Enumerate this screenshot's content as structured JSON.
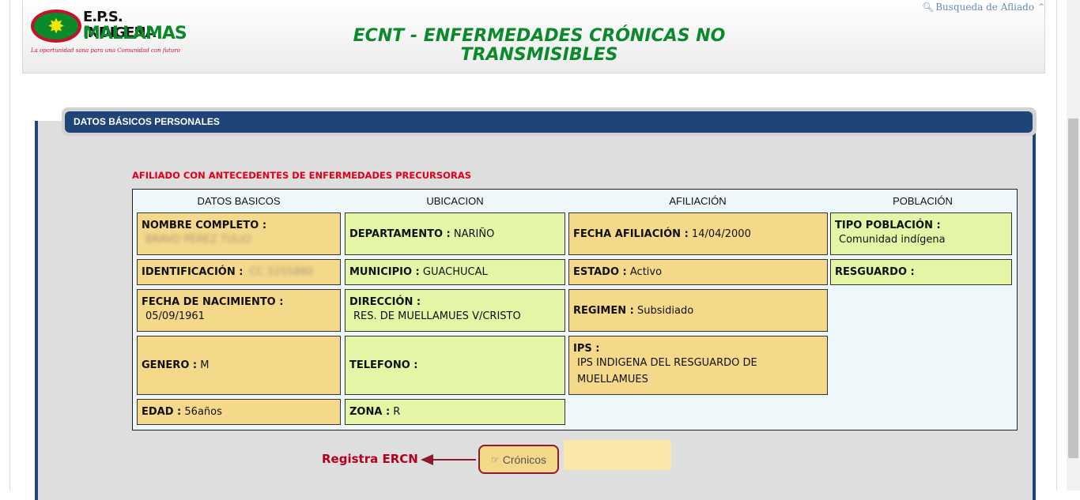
{
  "header": {
    "logo_line1": "E.P.S. INDIGENA",
    "logo_line2": "MALLAMAS",
    "logo_tagline": "La oportunidad sana para una Comunidad con futuro",
    "title": "ECNT - ENFERMEDADES CRÓNICAS NO TRANSMISIBLES",
    "search_link": "Busqueda de Afliado"
  },
  "panel": {
    "title": "DATOS BÁSICOS PERSONALES",
    "alert": "AFILIADO CON ANTECEDENTES DE ENFERMEDADES PRECURSORAS",
    "columns": [
      "DATOS BASICOS",
      "UBICACION",
      "AFILIACIÓN",
      "POBLACIÓN"
    ],
    "basic": {
      "nombre_label": "NOMBRE COMPLETO",
      "nombre_value": "BRAVO PEREZ TULIO",
      "id_label": "IDENTIFICACIÓN",
      "id_value": "CC 5255880",
      "nacimiento_label": "FECHA DE NACIMIENTO",
      "nacimiento_value": "05/09/1961",
      "genero_label": "GENERO",
      "genero_value": "M",
      "edad_label": "EDAD",
      "edad_value": "56años"
    },
    "ubicacion": {
      "departamento_label": "DEPARTAMENTO",
      "departamento_value": "NARIÑO",
      "municipio_label": "MUNICIPIO",
      "municipio_value": "GUACHUCAL",
      "direccion_label": "DIRECCIÓN",
      "direccion_value": "RES. DE MUELLAMUES V/CRISTO",
      "telefono_label": "TELEFONO",
      "telefono_value": "",
      "zona_label": "ZONA",
      "zona_value": "R"
    },
    "afiliacion": {
      "fecha_label": "FECHA AFILIACIÓN",
      "fecha_value": "14/04/2000",
      "estado_label": "ESTADO",
      "estado_value": "Activo",
      "regimen_label": "REGIMEN",
      "regimen_value": "Subsidiado",
      "ips_label": "IPS",
      "ips_value": "IPS INDIGENA DEL RESGUARDO DE MUELLAMUES"
    },
    "poblacion": {
      "tipo_label": "TIPO POBLACIÓN",
      "tipo_value": "Comunidad indígena",
      "resguardo_label": "RESGUARDO",
      "resguardo_value": ""
    }
  },
  "actions": {
    "registra_label": "Registra ERCN",
    "cronicos_button": "Crónicos"
  },
  "colors": {
    "brand_green": "#0a8a2a",
    "panel_blue": "#1f4578",
    "alert_red": "#e0001b",
    "cell_orange": "#f5d98a",
    "cell_green": "#e4f5a5"
  }
}
